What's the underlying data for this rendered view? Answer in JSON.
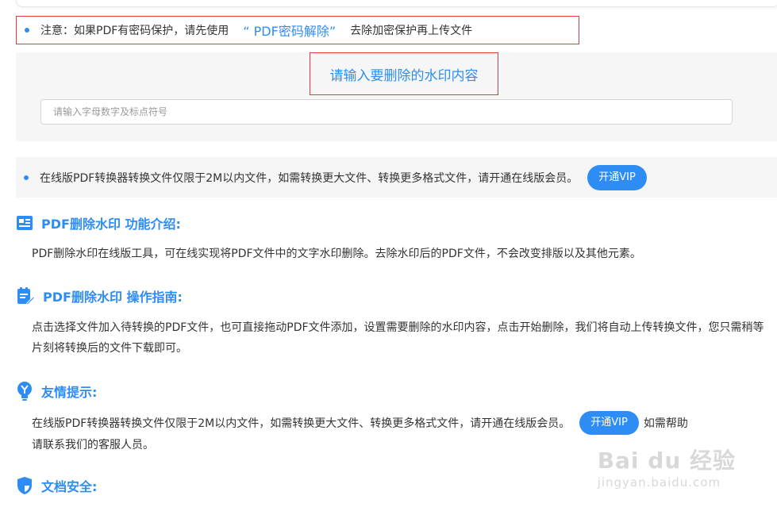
{
  "notice": {
    "prefix": "注意：如果PDF有密码保护，请先使用",
    "link": "“ PDF密码解除”",
    "suffix": "去除加密保护再上传文件"
  },
  "watermark_input": {
    "title": "请输入要删除的水印内容",
    "placeholder": "请输入字母数字及标点符号"
  },
  "vip_notice": {
    "text": "在线版PDF转换器转换文件仅限于2M以内文件，如需转换更大文件、转换更多格式文件，请开通在线版会员。",
    "button": "开通VIP"
  },
  "sections": {
    "intro": {
      "title": "PDF删除水印 功能介绍:",
      "body": "PDF删除水印在线版工具，可在线实现将PDF文件中的文字水印删除。去除水印后的PDF文件，不会改变排版以及其他元素。"
    },
    "guide": {
      "title": "PDF删除水印 操作指南:",
      "body": "点击选择文件加入待转换的PDF文件，也可直接拖动PDF文件添加，设置需要删除的水印内容，点击开始删除，我们将自动上传转换文件，您只需稍等片刻将转换后的文件下载即可。"
    },
    "tips": {
      "title": "友情提示:",
      "body": "在线版PDF转换器转换文件仅限于2M以内文件，如需转换更大文件、转换更多格式文件，请开通在线版会员。",
      "button": "开通VIP",
      "after": "如需帮助",
      "line2": "请联系我们的客服人员。"
    },
    "security": {
      "title": "文档安全:"
    }
  },
  "watermark_logo": {
    "main": "Bai du 经验",
    "url": "jingyan.baidu.com"
  },
  "colors": {
    "accent": "#2e8df5",
    "highlight_border": "#e23b3b",
    "panel_bg": "#f6f6f6"
  },
  "icons": {
    "bullet": "dot",
    "intro": "document-list-icon",
    "guide": "edit-document-icon",
    "tips": "lightbulb-icon",
    "security": "shield-icon"
  }
}
